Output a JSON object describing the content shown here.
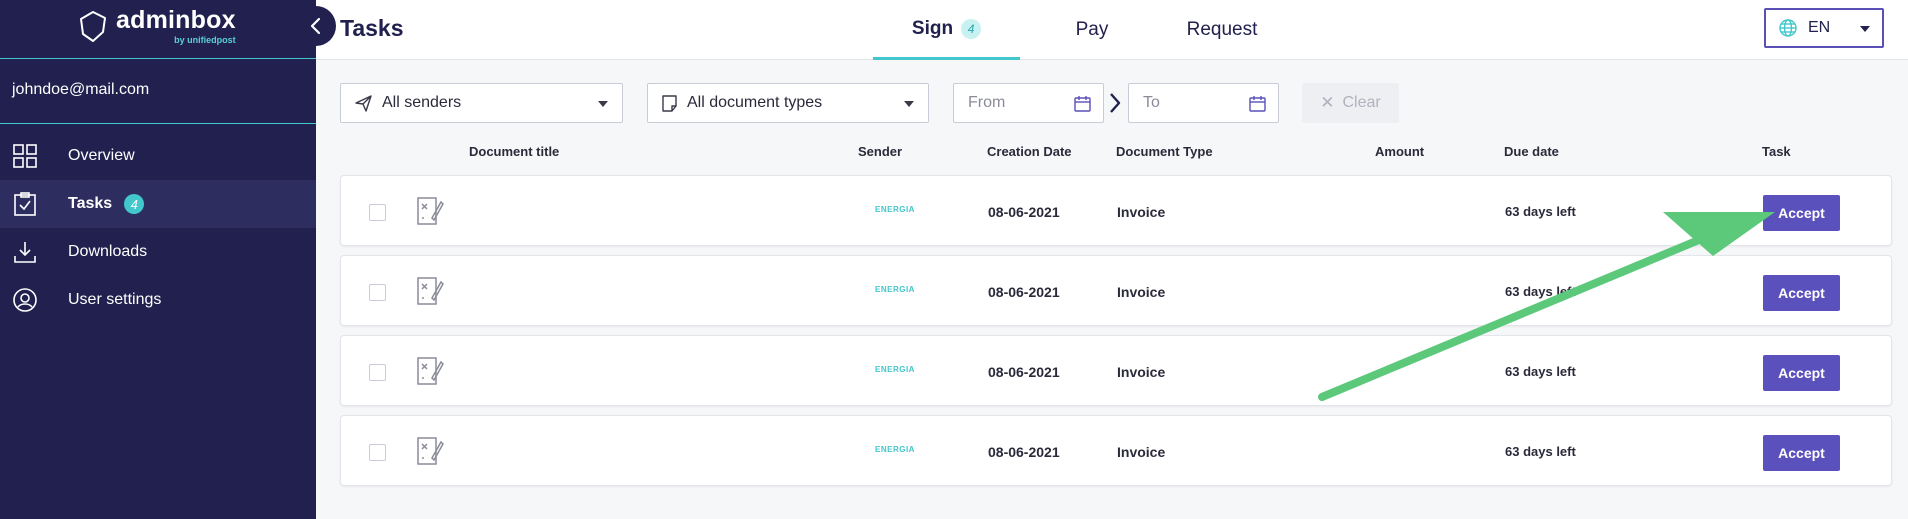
{
  "sidebar": {
    "logo": {
      "name": "adminbox",
      "sub": "by unifiedpost"
    },
    "user_email": "johndoe@mail.com",
    "items": [
      {
        "label": "Overview",
        "icon": "grid-icon"
      },
      {
        "label": "Tasks",
        "icon": "clipboard-check-icon",
        "badge": "4"
      },
      {
        "label": "Downloads",
        "icon": "download-icon"
      },
      {
        "label": "User settings",
        "icon": "user-circle-icon"
      }
    ]
  },
  "header": {
    "title": "Tasks",
    "tabs": [
      {
        "label": "Sign",
        "badge": "4"
      },
      {
        "label": "Pay"
      },
      {
        "label": "Request"
      }
    ],
    "language": "EN"
  },
  "filters": {
    "senders": "All senders",
    "doc_types": "All document types",
    "from": "From",
    "to": "To",
    "clear": "Clear"
  },
  "table": {
    "columns": [
      "Document title",
      "Sender",
      "Creation Date",
      "Document Type",
      "Amount",
      "Due date",
      "Task"
    ],
    "rows": [
      {
        "sender": "ENERGIA",
        "creation_date": "08-06-2021",
        "doc_type": "Invoice",
        "amount": "",
        "due": "63 days left",
        "task": "Accept"
      },
      {
        "sender": "ENERGIA",
        "creation_date": "08-06-2021",
        "doc_type": "Invoice",
        "amount": "",
        "due": "63 days left",
        "task": "Accept"
      },
      {
        "sender": "ENERGIA",
        "creation_date": "08-06-2021",
        "doc_type": "Invoice",
        "amount": "",
        "due": "63 days left",
        "task": "Accept"
      },
      {
        "sender": "ENERGIA",
        "creation_date": "08-06-2021",
        "doc_type": "Invoice",
        "amount": "",
        "due": "63 days left",
        "task": "Accept"
      }
    ]
  },
  "colors": {
    "sidebar_bg": "#21204f",
    "accent_teal": "#41c7cc",
    "button_purple": "#5b51bd",
    "highlight_yellow": "#f2c617",
    "arrow_green": "#5cc87a"
  }
}
